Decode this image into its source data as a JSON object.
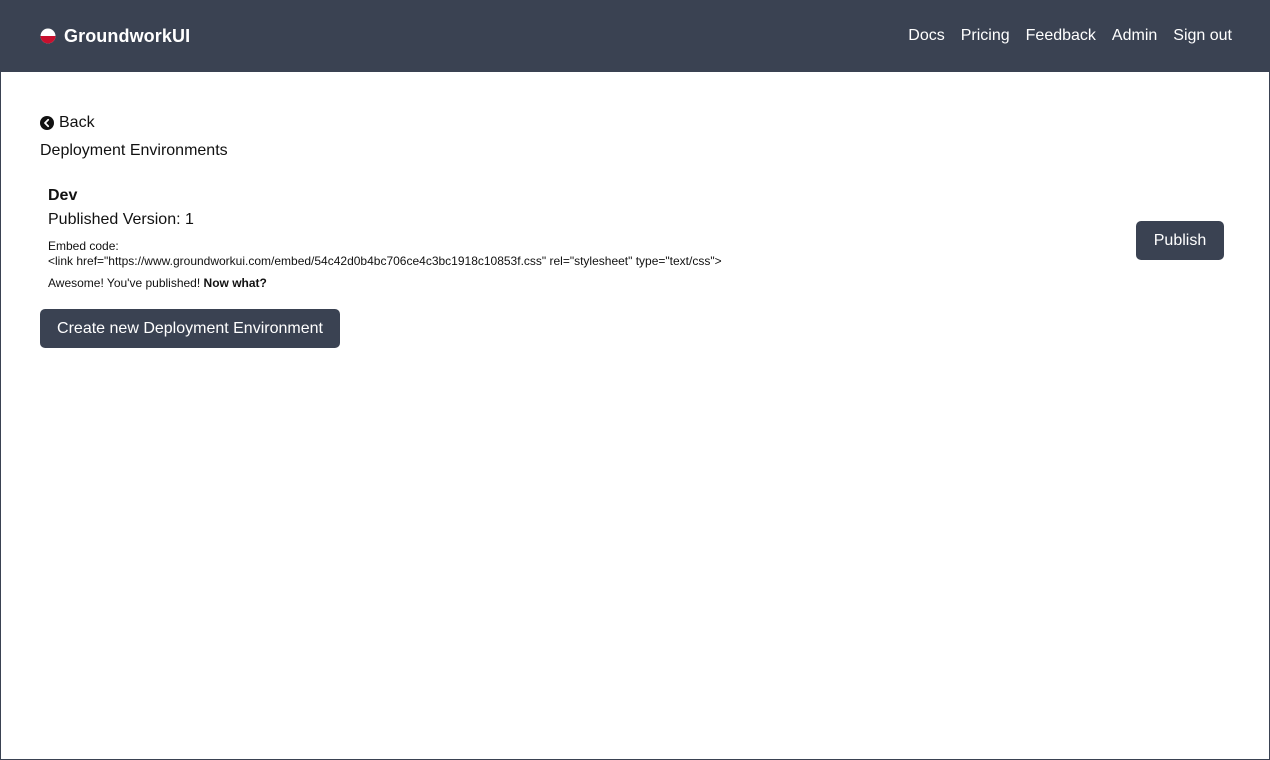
{
  "colors": {
    "navbar_bg": "#3a4252",
    "button_bg": "#3a4252",
    "logo_red": "#c8102e",
    "text": "#111111"
  },
  "navbar": {
    "brand": "GroundworkUI",
    "brand_icon": "half-red-circle-logo",
    "links": [
      {
        "label": "Docs"
      },
      {
        "label": "Pricing"
      },
      {
        "label": "Feedback"
      },
      {
        "label": "Admin"
      },
      {
        "label": "Sign out"
      }
    ]
  },
  "main": {
    "back_label": "Back",
    "back_icon": "chevron-left-circle-icon",
    "title": "Deployment Environments",
    "environments": [
      {
        "name": "Dev",
        "version_text": "Published Version: 1",
        "embed_label": "Embed code:",
        "embed_code": "<link href=\"https://www.groundworkui.com/embed/54c42d0b4bc706ce4c3bc1918c10853f.css\" rel=\"stylesheet\" type=\"text/css\">",
        "published_msg": "Awesome! You've published!",
        "published_msg_strong": "Now what?",
        "publish_label": "Publish"
      }
    ],
    "create_label": "Create new Deployment Environment"
  }
}
